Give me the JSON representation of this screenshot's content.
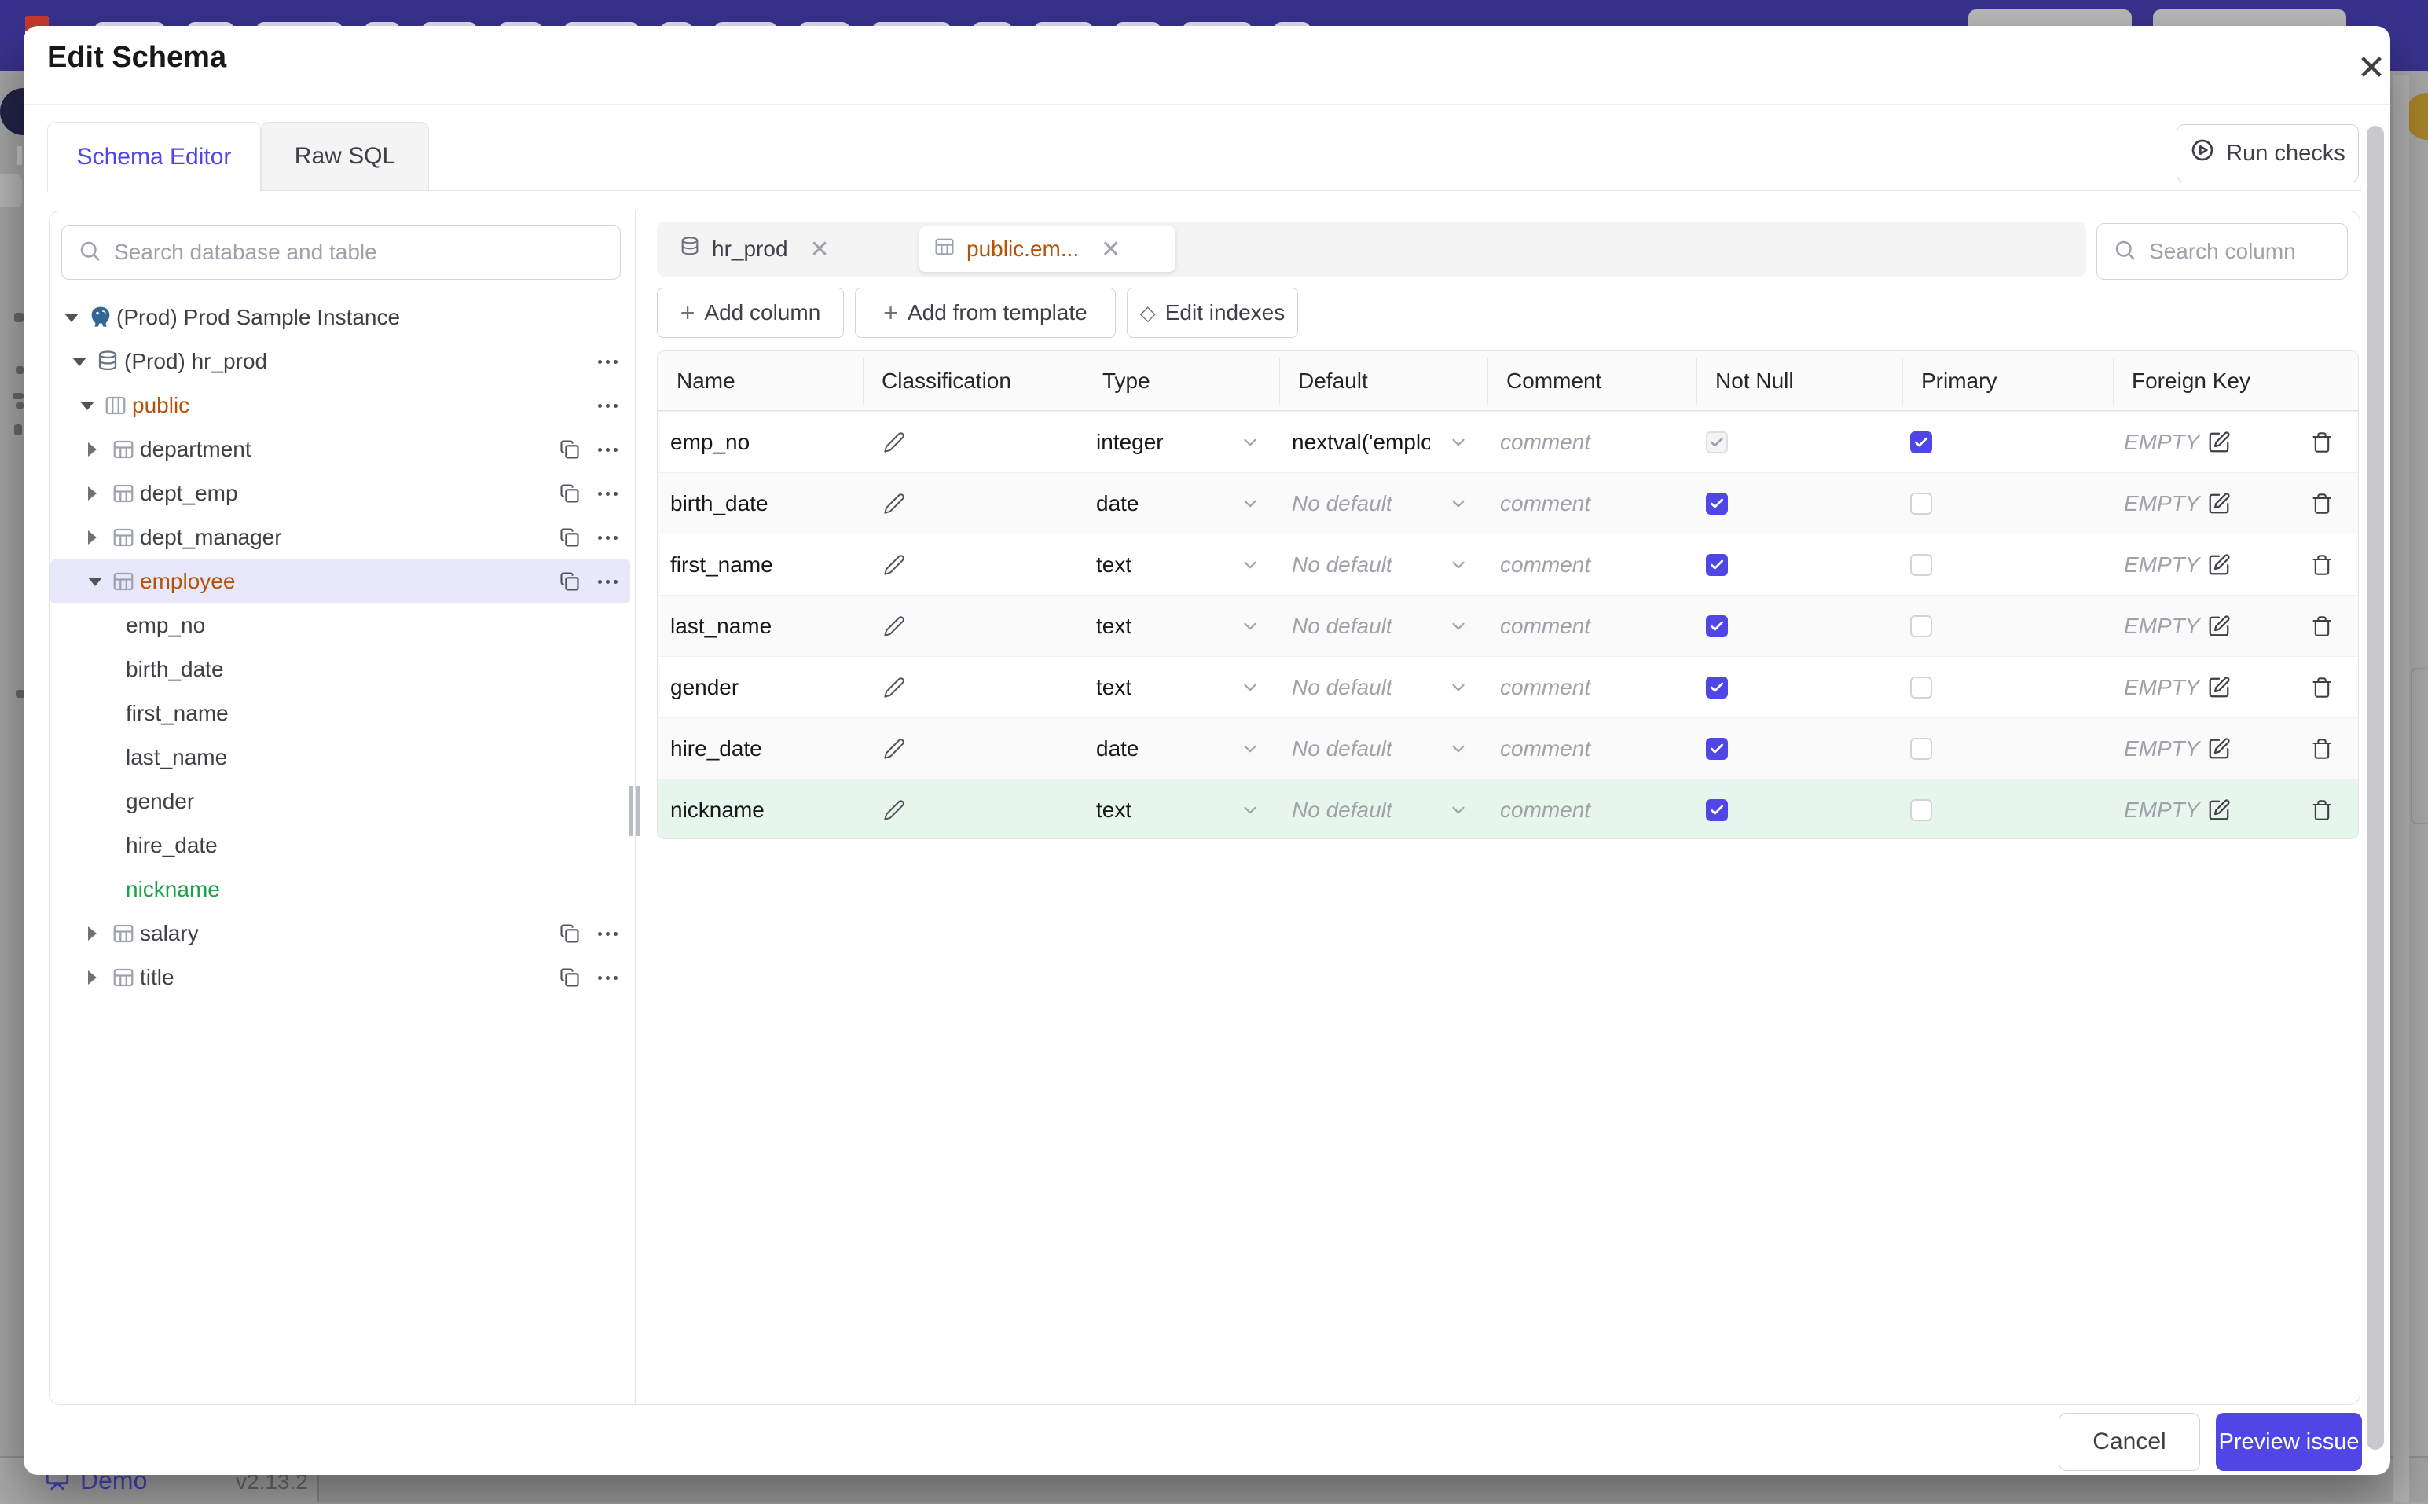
{
  "modal": {
    "title": "Edit Schema",
    "close_icon": "close-icon",
    "tabs": [
      {
        "label": "Schema Editor",
        "active": true
      },
      {
        "label": "Raw SQL",
        "active": false
      }
    ],
    "run_checks_label": "Run checks"
  },
  "sidebar": {
    "search_placeholder": "Search database and table",
    "tree": [
      {
        "depth": 0,
        "caret": "down",
        "icon": "postgres",
        "label": "(Prod) Prod Sample Instance",
        "color": null,
        "selected": false,
        "actions": []
      },
      {
        "depth": 1,
        "caret": "down",
        "icon": "database",
        "label": "(Prod) hr_prod",
        "color": null,
        "selected": false,
        "actions": [
          "more"
        ]
      },
      {
        "depth": 2,
        "caret": "down",
        "icon": "schema",
        "label": "public",
        "color": "amber",
        "selected": false,
        "actions": [
          "more"
        ]
      },
      {
        "depth": 3,
        "caret": "right",
        "icon": "table",
        "label": "department",
        "color": null,
        "selected": false,
        "actions": [
          "copy",
          "more"
        ]
      },
      {
        "depth": 3,
        "caret": "right",
        "icon": "table",
        "label": "dept_emp",
        "color": null,
        "selected": false,
        "actions": [
          "copy",
          "more"
        ]
      },
      {
        "depth": 3,
        "caret": "right",
        "icon": "table",
        "label": "dept_manager",
        "color": null,
        "selected": false,
        "actions": [
          "copy",
          "more"
        ]
      },
      {
        "depth": 3,
        "caret": "down",
        "icon": "table",
        "label": "employee",
        "color": "amber",
        "selected": true,
        "actions": [
          "copy",
          "more"
        ]
      },
      {
        "depth": 4,
        "caret": null,
        "icon": null,
        "label": "emp_no",
        "color": null,
        "selected": false,
        "actions": []
      },
      {
        "depth": 4,
        "caret": null,
        "icon": null,
        "label": "birth_date",
        "color": null,
        "selected": false,
        "actions": []
      },
      {
        "depth": 4,
        "caret": null,
        "icon": null,
        "label": "first_name",
        "color": null,
        "selected": false,
        "actions": []
      },
      {
        "depth": 4,
        "caret": null,
        "icon": null,
        "label": "last_name",
        "color": null,
        "selected": false,
        "actions": []
      },
      {
        "depth": 4,
        "caret": null,
        "icon": null,
        "label": "gender",
        "color": null,
        "selected": false,
        "actions": []
      },
      {
        "depth": 4,
        "caret": null,
        "icon": null,
        "label": "hire_date",
        "color": null,
        "selected": false,
        "actions": []
      },
      {
        "depth": 4,
        "caret": null,
        "icon": null,
        "label": "nickname",
        "color": "green",
        "selected": false,
        "actions": []
      },
      {
        "depth": 3,
        "caret": "right",
        "icon": "table",
        "label": "salary",
        "color": null,
        "selected": false,
        "actions": [
          "copy",
          "more"
        ]
      },
      {
        "depth": 3,
        "caret": "right",
        "icon": "table",
        "label": "title",
        "color": null,
        "selected": false,
        "actions": [
          "copy",
          "more"
        ]
      }
    ]
  },
  "editor": {
    "open_tabs": [
      {
        "label": "hr_prod",
        "icon": "database-icon",
        "active": false
      },
      {
        "label": "public.em...",
        "icon": "table-icon",
        "active": true
      }
    ],
    "search_placeholder": "Search column",
    "toolbar": {
      "add_column": "Add column",
      "add_from_template": "Add from template",
      "edit_indexes": "Edit indexes"
    }
  },
  "table": {
    "headers": [
      "Name",
      "Classification",
      "Type",
      "Default",
      "Comment",
      "Not Null",
      "Primary",
      "Foreign Key"
    ],
    "comment_placeholder": "comment",
    "no_default_placeholder": "No default",
    "foreign_key_empty": "EMPTY",
    "rows": [
      {
        "name": "emp_no",
        "type": "integer",
        "default": "nextval('employ",
        "default_is_placeholder": false,
        "not_null_checked": true,
        "not_null_disabled": true,
        "primary_checked": true,
        "foreign_key": "EMPTY",
        "highlight": false
      },
      {
        "name": "birth_date",
        "type": "date",
        "default": "No default",
        "default_is_placeholder": true,
        "not_null_checked": true,
        "not_null_disabled": false,
        "primary_checked": false,
        "foreign_key": "EMPTY",
        "highlight": false
      },
      {
        "name": "first_name",
        "type": "text",
        "default": "No default",
        "default_is_placeholder": true,
        "not_null_checked": true,
        "not_null_disabled": false,
        "primary_checked": false,
        "foreign_key": "EMPTY",
        "highlight": false
      },
      {
        "name": "last_name",
        "type": "text",
        "default": "No default",
        "default_is_placeholder": true,
        "not_null_checked": true,
        "not_null_disabled": false,
        "primary_checked": false,
        "foreign_key": "EMPTY",
        "highlight": false
      },
      {
        "name": "gender",
        "type": "text",
        "default": "No default",
        "default_is_placeholder": true,
        "not_null_checked": true,
        "not_null_disabled": false,
        "primary_checked": false,
        "foreign_key": "EMPTY",
        "highlight": false
      },
      {
        "name": "hire_date",
        "type": "date",
        "default": "No default",
        "default_is_placeholder": true,
        "not_null_checked": true,
        "not_null_disabled": false,
        "primary_checked": false,
        "foreign_key": "EMPTY",
        "highlight": false
      },
      {
        "name": "nickname",
        "type": "text",
        "default": "No default",
        "default_is_placeholder": true,
        "not_null_checked": true,
        "not_null_disabled": false,
        "primary_checked": false,
        "foreign_key": "EMPTY",
        "highlight": true
      }
    ]
  },
  "footer": {
    "cancel_label": "Cancel",
    "preview_label": "Preview issue"
  },
  "statusbar": {
    "demo_label": "Demo",
    "version": "v2.13.2"
  },
  "colors": {
    "accent": "#4f46e5",
    "amber_text": "#b45309",
    "green_text": "#16a34a",
    "green_row_bg": "#e7f6ed",
    "selected_tree_bg": "#e9e8fb",
    "topbar_dimmed": "#38328e"
  }
}
